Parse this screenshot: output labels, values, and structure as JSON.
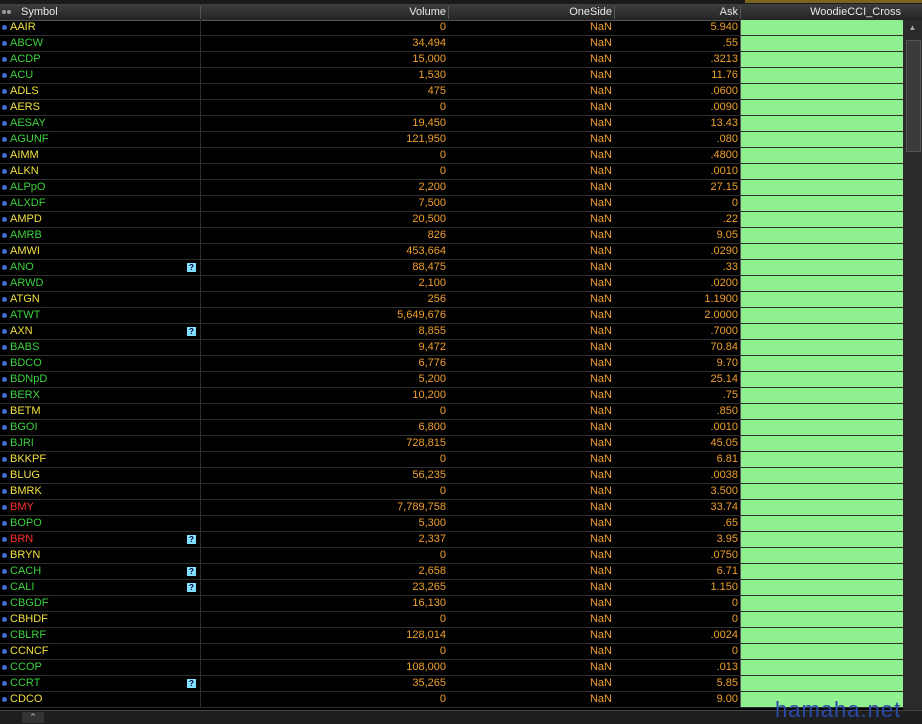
{
  "columns": {
    "symbol": "Symbol",
    "volume": "Volume",
    "oneside": "OneSide",
    "ask": "Ask",
    "cci": "WoodieCCI_Cross"
  },
  "colors": {
    "background": "#000000",
    "green": "#3ed23e",
    "yellow": "#f0e040",
    "red": "#ff3030",
    "value": "#f0a030",
    "cci_bg": "#90f090",
    "info": "#7fe0ff"
  },
  "info_icon_glyph": "?",
  "footer_icon": "chevron-up-icon",
  "rows": [
    {
      "s": "AAIR",
      "c": "yellow",
      "v": "0",
      "o": "NaN",
      "a": "5.940",
      "i": false
    },
    {
      "s": "ABCW",
      "c": "green",
      "v": "34,494",
      "o": "NaN",
      "a": ".55",
      "i": false
    },
    {
      "s": "ACDP",
      "c": "green",
      "v": "15,000",
      "o": "NaN",
      "a": ".3213",
      "i": false
    },
    {
      "s": "ACU",
      "c": "green",
      "v": "1,530",
      "o": "NaN",
      "a": "11.76",
      "i": false
    },
    {
      "s": "ADLS",
      "c": "yellow",
      "v": "475",
      "o": "NaN",
      "a": ".0600",
      "i": false
    },
    {
      "s": "AERS",
      "c": "yellow",
      "v": "0",
      "o": "NaN",
      "a": ".0090",
      "i": false
    },
    {
      "s": "AESAY",
      "c": "green",
      "v": "19,450",
      "o": "NaN",
      "a": "13.43",
      "i": false
    },
    {
      "s": "AGUNF",
      "c": "green",
      "v": "121,950",
      "o": "NaN",
      "a": ".080",
      "i": false
    },
    {
      "s": "AIMM",
      "c": "yellow",
      "v": "0",
      "o": "NaN",
      "a": ".4800",
      "i": false
    },
    {
      "s": "ALKN",
      "c": "yellow",
      "v": "0",
      "o": "NaN",
      "a": ".0010",
      "i": false
    },
    {
      "s": "ALPpO",
      "c": "green",
      "v": "2,200",
      "o": "NaN",
      "a": "27.15",
      "i": false
    },
    {
      "s": "ALXDF",
      "c": "green",
      "v": "7,500",
      "o": "NaN",
      "a": "0",
      "i": false
    },
    {
      "s": "AMPD",
      "c": "yellow",
      "v": "20,500",
      "o": "NaN",
      "a": ".22",
      "i": false
    },
    {
      "s": "AMRB",
      "c": "green",
      "v": "826",
      "o": "NaN",
      "a": "9.05",
      "i": false
    },
    {
      "s": "AMWI",
      "c": "yellow",
      "v": "453,664",
      "o": "NaN",
      "a": ".0290",
      "i": false
    },
    {
      "s": "ANO",
      "c": "green",
      "v": "88,475",
      "o": "NaN",
      "a": ".33",
      "i": true
    },
    {
      "s": "ARWD",
      "c": "green",
      "v": "2,100",
      "o": "NaN",
      "a": ".0200",
      "i": false
    },
    {
      "s": "ATGN",
      "c": "yellow",
      "v": "256",
      "o": "NaN",
      "a": "1.1900",
      "i": false
    },
    {
      "s": "ATWT",
      "c": "green",
      "v": "5,649,676",
      "o": "NaN",
      "a": "2.0000",
      "i": false
    },
    {
      "s": "AXN",
      "c": "yellow",
      "v": "8,855",
      "o": "NaN",
      "a": ".7000",
      "i": true
    },
    {
      "s": "BABS",
      "c": "green",
      "v": "9,472",
      "o": "NaN",
      "a": "70.84",
      "i": false
    },
    {
      "s": "BDCO",
      "c": "green",
      "v": "6,776",
      "o": "NaN",
      "a": "9.70",
      "i": false
    },
    {
      "s": "BDNpD",
      "c": "green",
      "v": "5,200",
      "o": "NaN",
      "a": "25.14",
      "i": false
    },
    {
      "s": "BERX",
      "c": "green",
      "v": "10,200",
      "o": "NaN",
      "a": ".75",
      "i": false
    },
    {
      "s": "BETM",
      "c": "yellow",
      "v": "0",
      "o": "NaN",
      "a": ".850",
      "i": false
    },
    {
      "s": "BGOI",
      "c": "green",
      "v": "6,800",
      "o": "NaN",
      "a": ".0010",
      "i": false
    },
    {
      "s": "BJRI",
      "c": "green",
      "v": "728,815",
      "o": "NaN",
      "a": "45.05",
      "i": false
    },
    {
      "s": "BKKPF",
      "c": "yellow",
      "v": "0",
      "o": "NaN",
      "a": "6.81",
      "i": false
    },
    {
      "s": "BLUG",
      "c": "yellow",
      "v": "56,235",
      "o": "NaN",
      "a": ".0038",
      "i": false
    },
    {
      "s": "BMRK",
      "c": "yellow",
      "v": "0",
      "o": "NaN",
      "a": "3.500",
      "i": false
    },
    {
      "s": "BMY",
      "c": "red",
      "v": "7,789,758",
      "o": "NaN",
      "a": "33.74",
      "i": false
    },
    {
      "s": "BOPO",
      "c": "green",
      "v": "5,300",
      "o": "NaN",
      "a": ".65",
      "i": false
    },
    {
      "s": "BRN",
      "c": "red",
      "v": "2,337",
      "o": "NaN",
      "a": "3.95",
      "i": true
    },
    {
      "s": "BRYN",
      "c": "yellow",
      "v": "0",
      "o": "NaN",
      "a": ".0750",
      "i": false
    },
    {
      "s": "CACH",
      "c": "green",
      "v": "2,658",
      "o": "NaN",
      "a": "6.71",
      "i": true
    },
    {
      "s": "CALI",
      "c": "green",
      "v": "23,265",
      "o": "NaN",
      "a": "1.150",
      "i": true
    },
    {
      "s": "CBGDF",
      "c": "green",
      "v": "16,130",
      "o": "NaN",
      "a": "0",
      "i": false
    },
    {
      "s": "CBHDF",
      "c": "yellow",
      "v": "0",
      "o": "NaN",
      "a": "0",
      "i": false
    },
    {
      "s": "CBLRF",
      "c": "green",
      "v": "128,014",
      "o": "NaN",
      "a": ".0024",
      "i": false
    },
    {
      "s": "CCNCF",
      "c": "yellow",
      "v": "0",
      "o": "NaN",
      "a": "0",
      "i": false
    },
    {
      "s": "CCOP",
      "c": "green",
      "v": "108,000",
      "o": "NaN",
      "a": ".013",
      "i": false
    },
    {
      "s": "CCRT",
      "c": "green",
      "v": "35,265",
      "o": "NaN",
      "a": "5.85",
      "i": true
    },
    {
      "s": "CDCO",
      "c": "yellow",
      "v": "0",
      "o": "NaN",
      "a": "9.00",
      "i": false
    }
  ],
  "watermark": "hamaha.net"
}
